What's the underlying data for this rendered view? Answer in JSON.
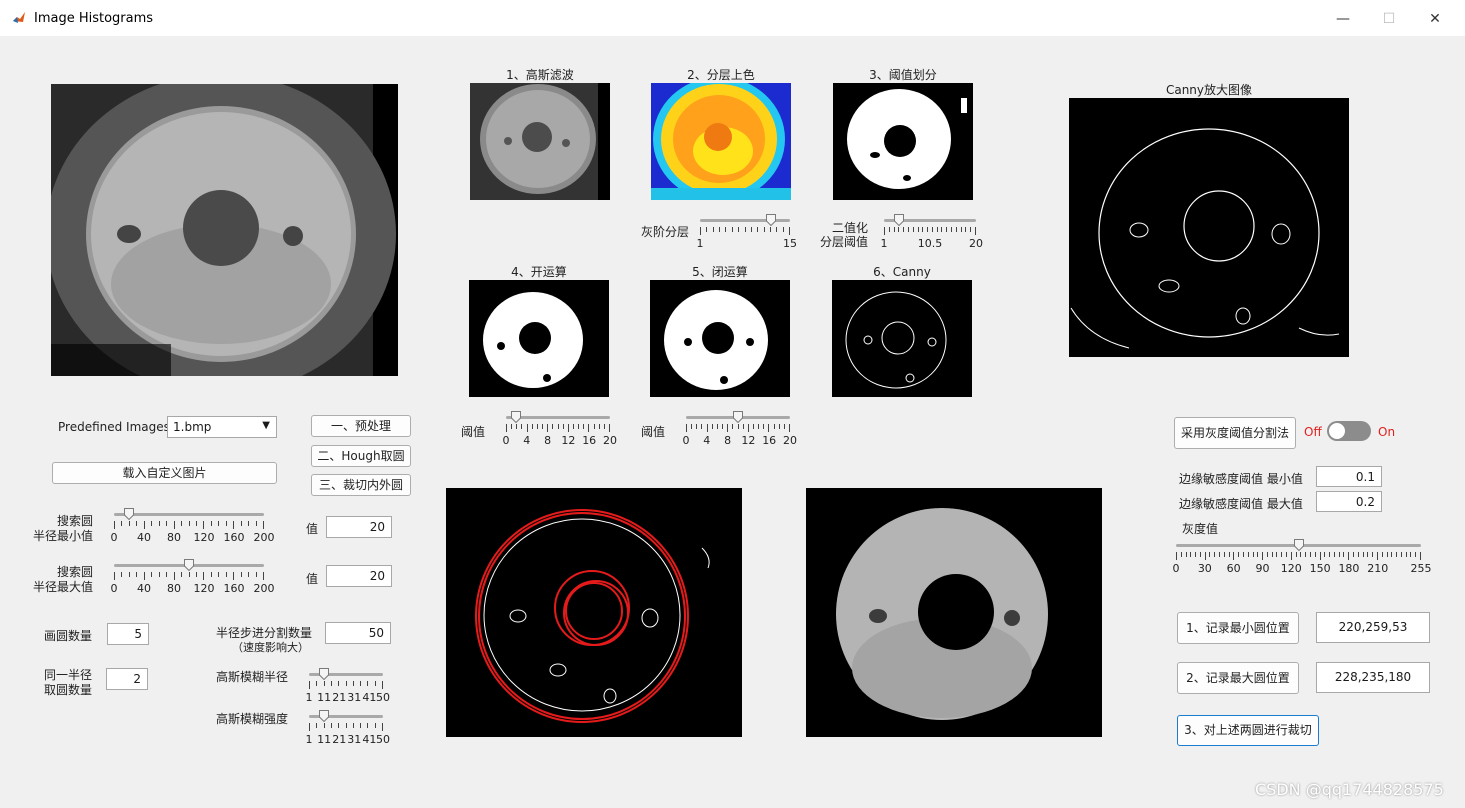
{
  "window": {
    "title": "Image Histograms",
    "minimize": "—",
    "maximize": "☐",
    "close": "✕"
  },
  "thumbs": {
    "gauss": "1、高斯滤波",
    "layer": "2、分层上色",
    "thresh": "3、阈值划分",
    "open": "4、开运算",
    "close": "5、闭运算",
    "canny": "6、Canny",
    "canny_big": "Canny放大图像"
  },
  "thumb_sliders": {
    "layer": {
      "label": "灰阶分层",
      "min": "1",
      "max": "15",
      "value": 12
    },
    "binary": {
      "label1": "二值化",
      "label2": "分层阈值",
      "min": "1",
      "mid": "10.5",
      "max": "20",
      "value": 4
    },
    "open": {
      "label": "阈值",
      "ticks": [
        "0",
        "4",
        "8",
        "12",
        "16",
        "20"
      ],
      "value": 2
    },
    "close": {
      "label": "阈值",
      "ticks": [
        "0",
        "4",
        "8",
        "12",
        "16",
        "20"
      ],
      "value": 10
    }
  },
  "left": {
    "predefined_label": "Predefined Images",
    "predefined_value": "1.bmp",
    "load_custom": "载入自定义图片",
    "btn_pre": "一、预处理",
    "btn_hough": "二、Hough取圆",
    "btn_crop": "三、裁切内外圆",
    "min_radius_label1": "搜索圆",
    "min_radius_label2": "半径最小值",
    "max_radius_label1": "搜索圆",
    "max_radius_label2": "半径最大值",
    "radius_ticks": [
      "0",
      "40",
      "80",
      "120",
      "160",
      "200"
    ],
    "min_radius_value": 20,
    "max_radius_value": 100,
    "value_label": "值",
    "min_radius_edit": "20",
    "max_radius_edit": "20",
    "circle_count_label": "画圆数量",
    "circle_count": "5",
    "same_radius_label1": "同一半径",
    "same_radius_label2": "取圆数量",
    "same_radius": "2",
    "step_label1": "半径步进分割数量",
    "step_label2": "（速度影响大）",
    "step_value": "50",
    "blur_radius_label": "高斯模糊半径",
    "blur_strength_label": "高斯模糊强度",
    "blur_ticks": [
      "1",
      "11",
      "21",
      "31",
      "41",
      "50"
    ],
    "blur_radius_value": 11,
    "blur_strength_value": 11
  },
  "right": {
    "gray_seg_button": "采用灰度阈值分割法",
    "toggle_off": "Off",
    "toggle_on": "On",
    "edge_min_label": "边缘敏感度阈值 最小值",
    "edge_min": "0.1",
    "edge_max_label": "边缘敏感度阈值 最大值",
    "edge_max": "0.2",
    "gray_label": "灰度值",
    "gray_ticks": [
      "0",
      "30",
      "60",
      "90",
      "120",
      "150",
      "180",
      "210",
      "255"
    ],
    "gray_value": 128,
    "rec_min_button": "1、记录最小圆位置",
    "rec_min_value": "220,259,53",
    "rec_max_button": "2、记录最大圆位置",
    "rec_max_value": "228,235,180",
    "crop_button": "3、对上述两圆进行裁切"
  },
  "watermark": "CSDN @qq1744828575"
}
